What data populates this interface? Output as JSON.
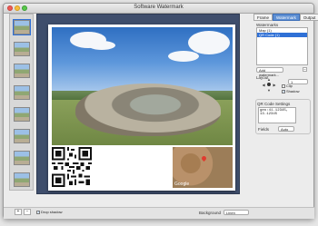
{
  "window": {
    "title": "Software Watermark"
  },
  "panel": {
    "tabs": [
      "Frame",
      "Watermark",
      "Output"
    ],
    "section_label": "Watermarks",
    "watermarks": [
      "Map (1)",
      "QR Code (1)"
    ],
    "add_watermark_label": "Add watermark...",
    "layout_label": "Layout",
    "clip_label": "Clip",
    "shadow_label": "Shadow",
    "qr_settings_label": "QR Code Settings",
    "qr_text": "geo:41.12345,\n13.12345",
    "fields_label": "Fields",
    "fields_value": "Auto"
  },
  "bottom": {
    "show_shadow_label": "Drop shadow",
    "background_label": "Background",
    "background_value": "Linen"
  },
  "map": {
    "brand": "Google"
  },
  "colors": {
    "stage": "#3f4e6c",
    "accent": "#2f70d6"
  }
}
